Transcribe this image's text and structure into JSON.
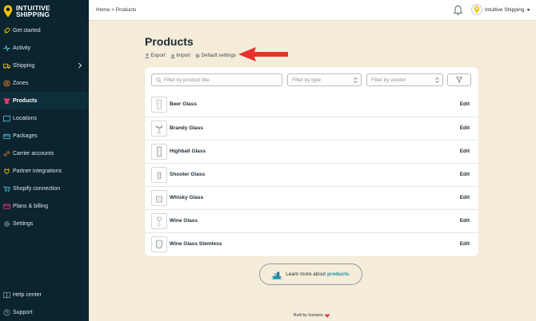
{
  "brand": {
    "line1": "INTUITIVE",
    "line2": "SHIPPING",
    "pin_color": "#f2c200"
  },
  "sidebar": {
    "items": [
      {
        "label": "Get started",
        "icon": "rocket-icon"
      },
      {
        "label": "Activity",
        "icon": "activity-icon"
      },
      {
        "label": "Shipping",
        "icon": "truck-icon"
      },
      {
        "label": "Zones",
        "icon": "target-icon"
      },
      {
        "label": "Products",
        "icon": "shirt-icon"
      },
      {
        "label": "Locations",
        "icon": "map-icon"
      },
      {
        "label": "Packages",
        "icon": "package-icon"
      },
      {
        "label": "Carrier accounts",
        "icon": "link-icon"
      },
      {
        "label": "Partner integrations",
        "icon": "plug-icon"
      },
      {
        "label": "Shopify connection",
        "icon": "cart-icon"
      },
      {
        "label": "Plans & billing",
        "icon": "card-icon"
      },
      {
        "label": "Settings",
        "icon": "gear-icon"
      }
    ],
    "bottom_items": [
      {
        "label": "Help center",
        "icon": "book-icon"
      },
      {
        "label": "Support",
        "icon": "help-icon"
      }
    ]
  },
  "topbar": {
    "breadcrumb": "Home > Products",
    "user_name": "Intuitive Shipping"
  },
  "page": {
    "title": "Products",
    "actions": {
      "export": "Export",
      "import": "Import",
      "default_settings": "Default settings"
    }
  },
  "filters": {
    "search_placeholder": "Filter by product title",
    "type_placeholder": "Filter by type",
    "vendor_placeholder": "Filter by vendor"
  },
  "products": [
    {
      "name": "Beer Glass",
      "edit": "Edit"
    },
    {
      "name": "Brandy Glass",
      "edit": "Edit"
    },
    {
      "name": "Highball Glass",
      "edit": "Edit"
    },
    {
      "name": "Shooter Glass",
      "edit": "Edit"
    },
    {
      "name": "Whisky Glass",
      "edit": "Edit"
    },
    {
      "name": "Wine Glass",
      "edit": "Edit"
    },
    {
      "name": "Wine Glass Stemless",
      "edit": "Edit"
    }
  ],
  "learn_more": {
    "prefix": "Learn more about",
    "link": "products",
    "suffix": "."
  },
  "footer": {
    "text": "Built by humans"
  },
  "colors": {
    "sidebar_bg": "#0b2430",
    "page_bg": "#f5ecda",
    "accent": "#f2c200",
    "active_icon": "#e6396b",
    "arrow": "#e8312a",
    "link": "#1a8fb0"
  }
}
